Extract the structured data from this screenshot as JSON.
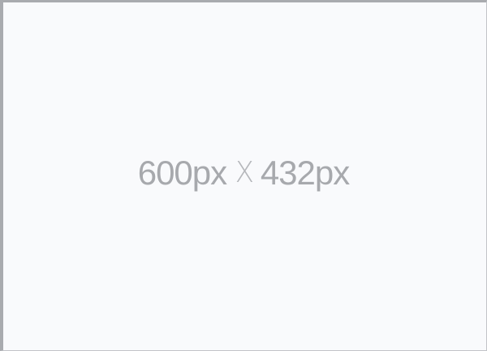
{
  "placeholder": {
    "width_text": "600px",
    "times_glyph": "X",
    "height_text": "432px"
  }
}
